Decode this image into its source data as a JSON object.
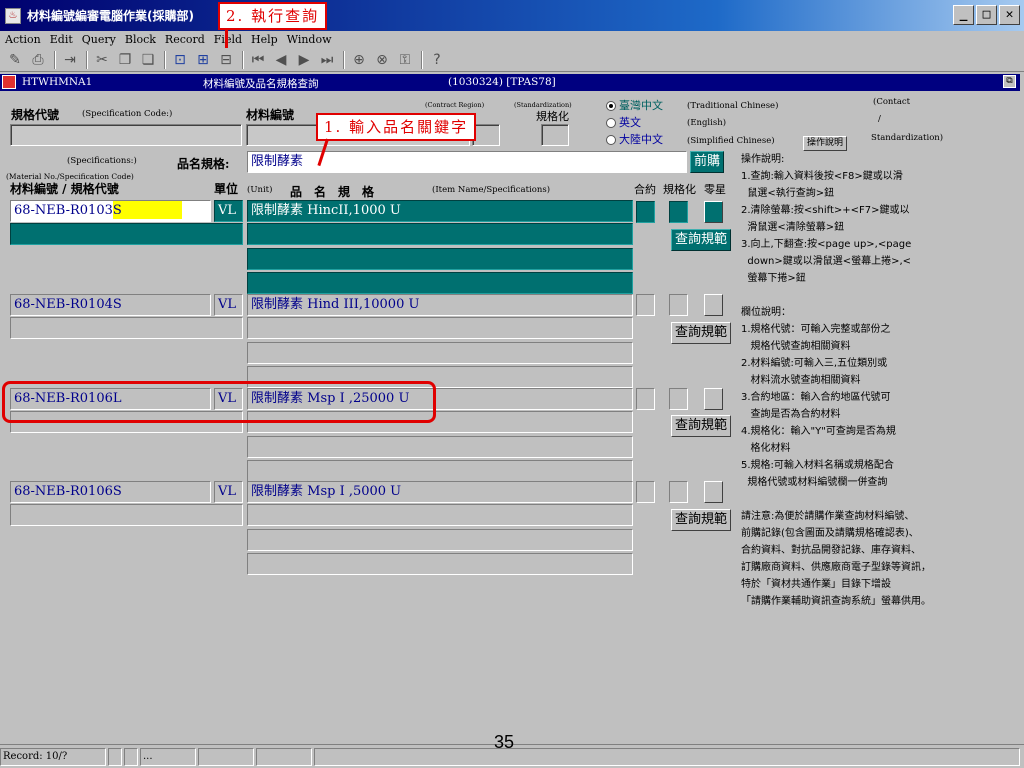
{
  "window": {
    "title": "材料編號編審電腦作業(採購部)"
  },
  "menu": [
    "Action",
    "Edit",
    "Query",
    "Block",
    "Record",
    "Field",
    "Help",
    "Window"
  ],
  "doc": {
    "code": "HTWHMNA1",
    "title": "材料編號及品名規格查詢",
    "info": "(1030324) [TPAS78]"
  },
  "header": {
    "spec_code_label": "規格代號",
    "spec_code_en": "(Specification Code:)",
    "material_no_label": "材料編號",
    "contract_region_en": "(Contract Region)",
    "standardization_en": "(Standardization)",
    "standardization_label": "規格化",
    "lang_options": [
      {
        "label": "臺灣中文",
        "en": "(Traditional Chinese)",
        "selected": true
      },
      {
        "label": "英文",
        "en": "(English)",
        "selected": false
      },
      {
        "label": "大陸中文",
        "en": "(Simplified Chinese)",
        "selected": false
      }
    ],
    "contact_en": "(Contact",
    "slash": "/",
    "standardization_en2": "Standardization)",
    "help_button": "操作說明",
    "specifications_en": "(Specifications:)",
    "item_spec_label": "品名規格:",
    "item_spec_value": "限制酵素",
    "prev_purchase_button": "前購"
  },
  "columns": {
    "matno_en": "(Material No./Specification Code)",
    "matno_label": "材料編號 / 規格代號",
    "unit_label": "單位",
    "unit_en": "(Unit)",
    "item_label": "品　名　規　格",
    "item_en": "(Item Name/Specifications)",
    "contract": "合約",
    "standardized": "規格化",
    "parts": "零星"
  },
  "rows": [
    {
      "matno_prefix": "68-NEB-R0103",
      "matno_highlight": "S",
      "unit": "VL",
      "item": "限制酵素 HincII,1000 U",
      "query_button": "查詢規範"
    },
    {
      "matno_prefix": "68-NEB-R0104S",
      "matno_highlight": "",
      "unit": "VL",
      "item": "限制酵素 Hind III,10000 U",
      "query_button": "查詢規範"
    },
    {
      "matno_prefix": "68-NEB-R0106L",
      "matno_highlight": "",
      "unit": "VL",
      "item": "限制酵素 Msp I ,25000 U",
      "query_button": "查詢規範"
    },
    {
      "matno_prefix": "68-NEB-R0106S",
      "matno_highlight": "",
      "unit": "VL",
      "item": "限制酵素 Msp I ,5000 U",
      "query_button": "查詢規範"
    }
  ],
  "help_text": "操作說明:\n1.查詢:輸入資料後按<F8>鍵或以滑\n  鼠選<執行查詢>鈕\n2.清除螢幕:按<shift>+<F7>鍵或以\n  滑鼠選<清除螢幕>鈕\n3.向上,下翻查:按<page up>,<page\n  down>鍵或以滑鼠選<螢幕上捲>,<\n  螢幕下捲>鈕\n\n欄位說明：\n1.規格代號：可輸入完整或部份之\n   規格代號查詢相關資料\n2.材料編號:可輸入三,五位類別或\n   材料流水號查詢相關資料\n3.合約地區：輸入合約地區代號可\n   查詢是否為合約材料\n4.規格化：輸入\"Y\"可查詢是否為規\n   格化材料\n5.規格:可輸入材料名稱或規格配合\n  規格代號或材料編號欄一併查詢\n\n請注意:為便於請購作業查詢材料編號、\n前購記錄(包含圖面及請購規格確認表)、\n合約資料、對抗品開發記錄、庫存資料、\n訂購廠商資料、供應廠商電子型錄等資訊，\n特於「資材共通作業」目錄下增設\n「請購作業輔助資訊查詢系統」螢幕供用。",
  "annotations": {
    "step1": "1. 輸入品名關鍵字",
    "step2": "2. 執行查詢"
  },
  "status": {
    "record": "Record: 10/?",
    "ellipsis": "..."
  },
  "page_number": "35"
}
